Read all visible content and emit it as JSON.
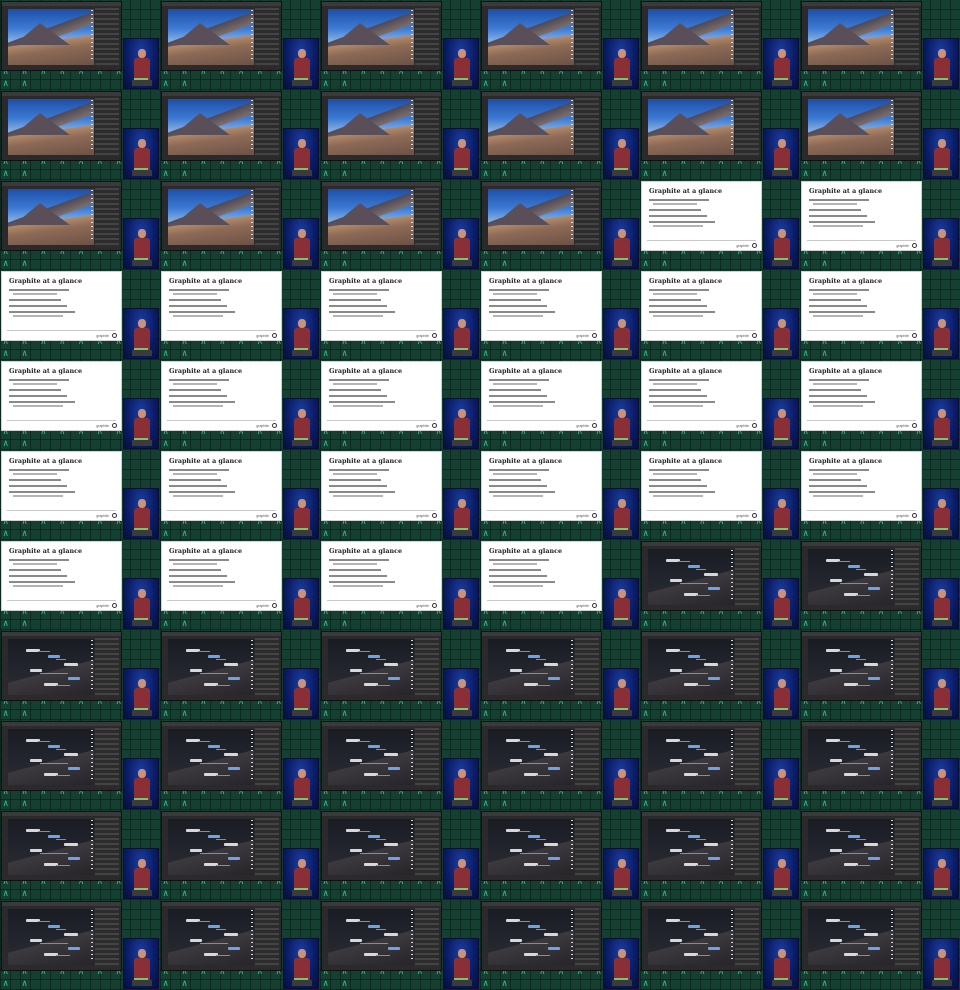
{
  "grid": {
    "columns": 6,
    "rows": 11
  },
  "colors": {
    "background": "#123a2e",
    "glyph": "#3fe0a8",
    "speaker_shirt": "#8b2f37",
    "camera_backdrop": "#1b3fa0"
  },
  "slide": {
    "title": "Graphite at a glance",
    "brand": "graphite"
  },
  "frame_sequence": [
    "editor",
    "editor",
    "editor",
    "editor",
    "editor",
    "editor",
    "editor",
    "editor",
    "editor",
    "editor",
    "editor",
    "editor",
    "editor",
    "editor",
    "editor",
    "editor",
    "slide",
    "slide",
    "slide",
    "slide",
    "slide",
    "slide",
    "slide",
    "slide",
    "slide",
    "slide",
    "slide",
    "slide",
    "slide",
    "slide",
    "slide",
    "slide",
    "slide",
    "slide",
    "slide",
    "slide",
    "slide",
    "slide",
    "slide",
    "slide",
    "node-editor",
    "node-editor",
    "node-editor",
    "node-editor",
    "node-editor",
    "node-editor",
    "node-editor",
    "node-editor",
    "node-editor",
    "node-editor",
    "node-editor",
    "node-editor",
    "node-editor",
    "node-editor",
    "node-editor",
    "node-editor",
    "node-editor",
    "node-editor",
    "node-editor",
    "node-editor",
    "node-editor",
    "node-editor",
    "node-editor",
    "node-editor",
    "node-editor",
    "node-editor"
  ]
}
